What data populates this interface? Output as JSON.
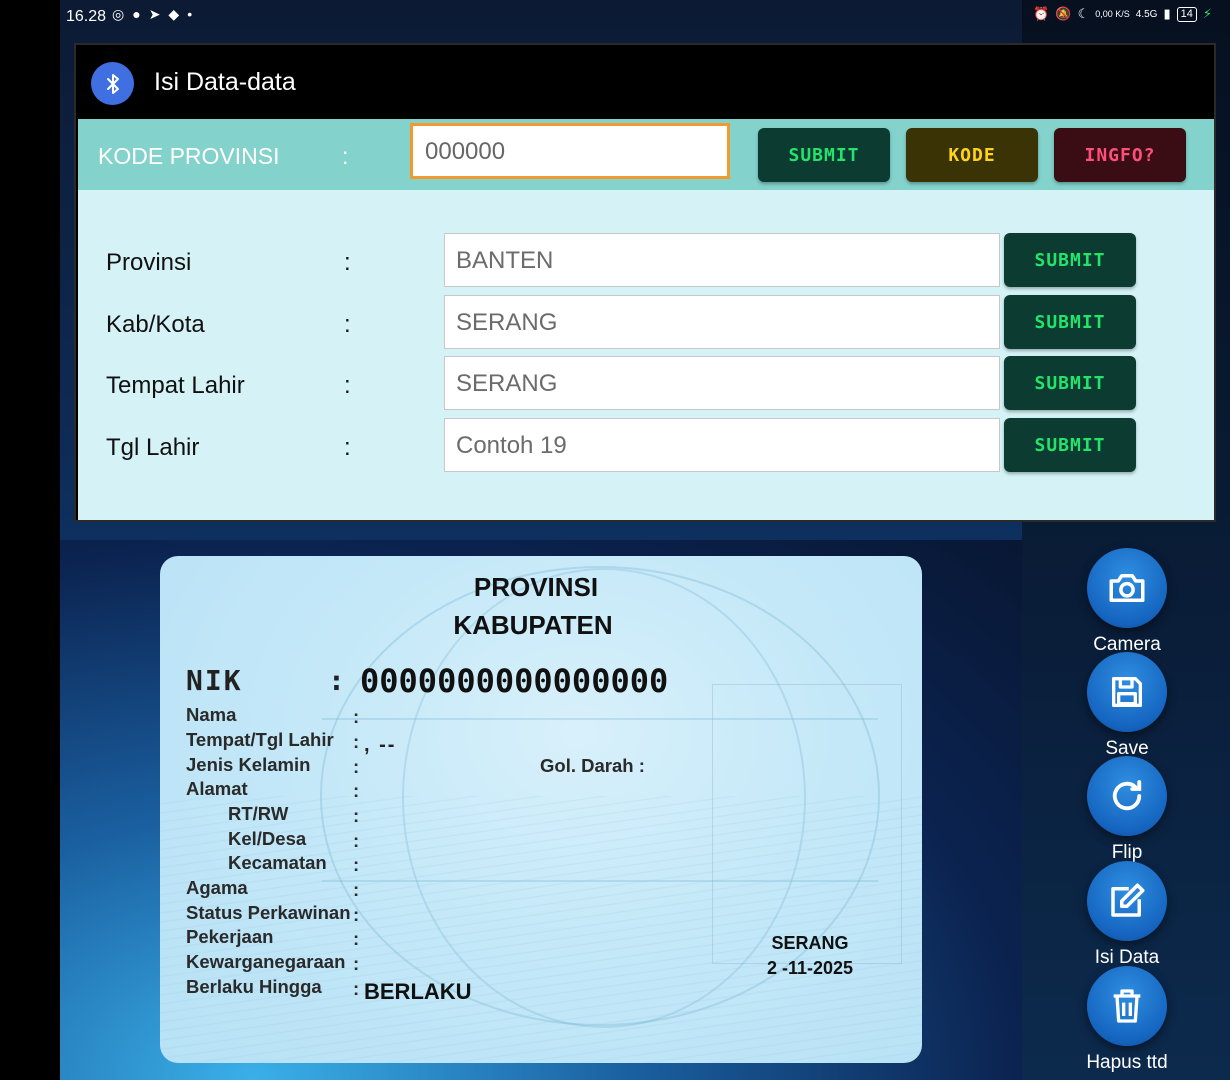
{
  "status_bar": {
    "time": "16.28",
    "speed": "0,00 K/S",
    "network": "4.5G",
    "battery": "14"
  },
  "dialog": {
    "title": "Isi Data-data",
    "kode_row": {
      "label": "KODE PROVINSI",
      "colon": ":",
      "value": "000000",
      "submit_label": "SUBMIT",
      "kode_label": "KODE",
      "ingfo_label": "INGFO?"
    },
    "fields": [
      {
        "label": "Provinsi",
        "colon": ":",
        "value": "BANTEN",
        "button": "SUBMIT"
      },
      {
        "label": "Kab/Kota",
        "colon": ":",
        "value": "SERANG",
        "button": "SUBMIT"
      },
      {
        "label": "Tempat Lahir",
        "colon": ":",
        "value": "SERANG",
        "button": "SUBMIT"
      },
      {
        "label": "Tgl Lahir",
        "colon": ":",
        "value": "Contoh 19",
        "button": "SUBMIT"
      }
    ]
  },
  "ktp": {
    "provinsi": "PROVINSI",
    "kabupaten": "KABUPATEN",
    "nik_label": "NIK",
    "nik_colon": ":",
    "nik_value": "0000000000000000",
    "rows": [
      {
        "label": "Nama",
        "colon": ":"
      },
      {
        "label": "Tempat/Tgl Lahir",
        "colon": ":"
      },
      {
        "label": "Jenis Kelamin",
        "colon": ":"
      },
      {
        "label": "Alamat",
        "colon": ":"
      },
      {
        "label": "RT/RW",
        "colon": ":"
      },
      {
        "label": "Kel/Desa",
        "colon": ":"
      },
      {
        "label": "Kecamatan",
        "colon": ":"
      },
      {
        "label": "Agama",
        "colon": ":"
      },
      {
        "label": "Status Perkawinan",
        "colon": ":"
      },
      {
        "label": "Pekerjaan",
        "colon": ":"
      },
      {
        "label": "Kewarganegaraan",
        "colon": ":"
      },
      {
        "label": "Berlaku Hingga",
        "colon": ":"
      }
    ],
    "ttl_value": ", --",
    "gol_darah": "Gol. Darah :",
    "berlaku_value": "BERLAKU",
    "city": "SERANG",
    "date": "2 -11-2025"
  },
  "side_actions": [
    {
      "label": "Camera",
      "icon": "camera-icon"
    },
    {
      "label": "Save",
      "icon": "save-icon"
    },
    {
      "label": "Flip",
      "icon": "refresh-icon"
    },
    {
      "label": "Isi Data",
      "icon": "edit-icon"
    },
    {
      "label": "Hapus ttd",
      "icon": "trash-icon"
    }
  ],
  "colors": {
    "dialog_body": "#d5f3f6",
    "kode_row": "#83d3cc",
    "submit_bg": "#0c3b32",
    "submit_text": "#25e36a",
    "kode_bg": "#3a3306",
    "kode_text": "#ffd21d",
    "ingfo_bg": "#3a0d14",
    "ingfo_text": "#ff4e7a",
    "input_focus": "#f29a2e",
    "side_button": "#1565c0"
  }
}
